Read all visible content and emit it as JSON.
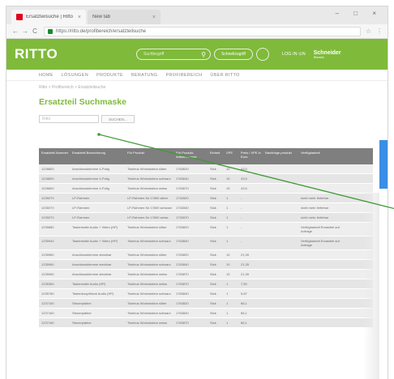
{
  "browser": {
    "tabs": [
      {
        "label": "Ersatzteilsuche | Ritto"
      },
      {
        "label": "New tab"
      }
    ],
    "url": "https://ritto.de/profibereich/ersatzteilsuche",
    "window_controls": "– □ ×"
  },
  "header": {
    "logo": "RITTO",
    "search_placeholder": "Suchbegriff",
    "pill_label": "Schnellzugriff",
    "login": "LOG IN ⊙N",
    "brand": "Schneider",
    "brand_sub": "Electric"
  },
  "nav": [
    "HOME",
    "LÖSUNGEN",
    "PRODUKTE",
    "BERATUNG",
    "PROFIBEREICH",
    "ÜBER RITTO"
  ],
  "breadcrumb": "Ritto > Profibereich > Ersatzteilsuche",
  "page_title": "Ersatzteil Suchmaske",
  "search": {
    "placeholder": "Ritto",
    "button": "SUCHEN..."
  },
  "table": {
    "headers": [
      "Ersatzteil-Nummer",
      "Ersatzteil-Bezeichnung",
      "Für Produkt",
      "Für Produkt-Artikelnummer",
      "Einheit",
      "VPE",
      "Preis / VPE in Euro",
      "Nachfolge-produkt",
      "Verfügbarkeit"
    ],
    "rows": [
      [
        "1228800",
        "Anschlussklemme 4-Polig",
        "Twinbus Wohnstation silber",
        "1763620",
        "Stck",
        "10",
        "43,5",
        "",
        ""
      ],
      [
        "1228800",
        "Anschlussklemme 4-Polig",
        "Twinbus Wohnstation schwarz",
        "1763640",
        "Stck",
        "10",
        "43,5",
        "",
        ""
      ],
      [
        "1228800",
        "Anschlussklemme 4-Polig",
        "Twinbus Wohnstation weiss",
        "1763670",
        "Stck",
        "10",
        "43,5",
        "",
        ""
      ],
      [
        "1235070",
        "LP-Rahmen",
        "LP-Rahmen für 17800 silber",
        "1732820",
        "Stck",
        "1",
        "-",
        "",
        "nicht mehr lieferbar"
      ],
      [
        "1235070",
        "LP-Rahmen",
        "LP-Rahmen für 17800 schwarz",
        "1732840",
        "Stck",
        "1",
        "-",
        "",
        "nicht mehr lieferbar"
      ],
      [
        "1235070",
        "LP-Rahmen",
        "LP-Rahmen für 17800 weiss",
        "1732870",
        "Stck",
        "1",
        "-",
        "",
        "nicht mehr lieferbar"
      ],
      [
        "1235880",
        "Tastermatte Audio + Video (HP)",
        "Twinbus Wohnstation silber",
        "1763820",
        "Stck",
        "1",
        "-",
        "",
        "Verfügbarkeit Ersatzteil auf Anfrage"
      ],
      [
        "1235940",
        "Tastermatte Audio + Video (HP)",
        "Twinbus Wohnstation schwarz",
        "1763840",
        "Stck",
        "1",
        "-",
        "",
        "Verfügbarkeit Ersatzteil auf Anfrage"
      ],
      [
        "1235960",
        "Anschlussklemme steckbar",
        "Twinbus Wohnstation silber",
        "1763820",
        "Stck",
        "10",
        "21,35",
        "",
        ""
      ],
      [
        "1235960",
        "Anschlussklemme steckbar",
        "Twinbus Wohnstation schwarz",
        "1763840",
        "Stck",
        "10",
        "21,35",
        "",
        ""
      ],
      [
        "1235960",
        "Anschlussklemme steckbar",
        "Twinbus Wohnstation weiss",
        "1763870",
        "Stck",
        "10",
        "21,35",
        "",
        ""
      ],
      [
        "1235360",
        "Tastermatte Audio (HP)",
        "Twinbus Wohnstation weiss",
        "1763870",
        "Stck",
        "1",
        "7,50",
        "",
        ""
      ],
      [
        "1235780",
        "Tastenknopfblock Audio (HP)",
        "Twinbus Wohnstation schwarz",
        "1763840",
        "Stck",
        "1",
        "5,87",
        "",
        ""
      ],
      [
        "1237160",
        "Steuerplatine",
        "Twinbus Wohnstation silber",
        "1763820",
        "Stck",
        "1",
        "66,1",
        "",
        ""
      ],
      [
        "1237160",
        "Steuerplatine",
        "Twinbus Wohnstation schwarz",
        "1763840",
        "Stck",
        "1",
        "66,1",
        "",
        ""
      ],
      [
        "1237160",
        "Steuerplatine",
        "Twinbus Wohnstation weiss",
        "1763870",
        "Stck",
        "1",
        "66,1",
        "",
        ""
      ]
    ]
  },
  "colors": {
    "brand_green": "#7fba3b",
    "header_gray": "#7f7f7f",
    "pointer": "#3f9a38",
    "side_tab": "#3a8ee6"
  }
}
